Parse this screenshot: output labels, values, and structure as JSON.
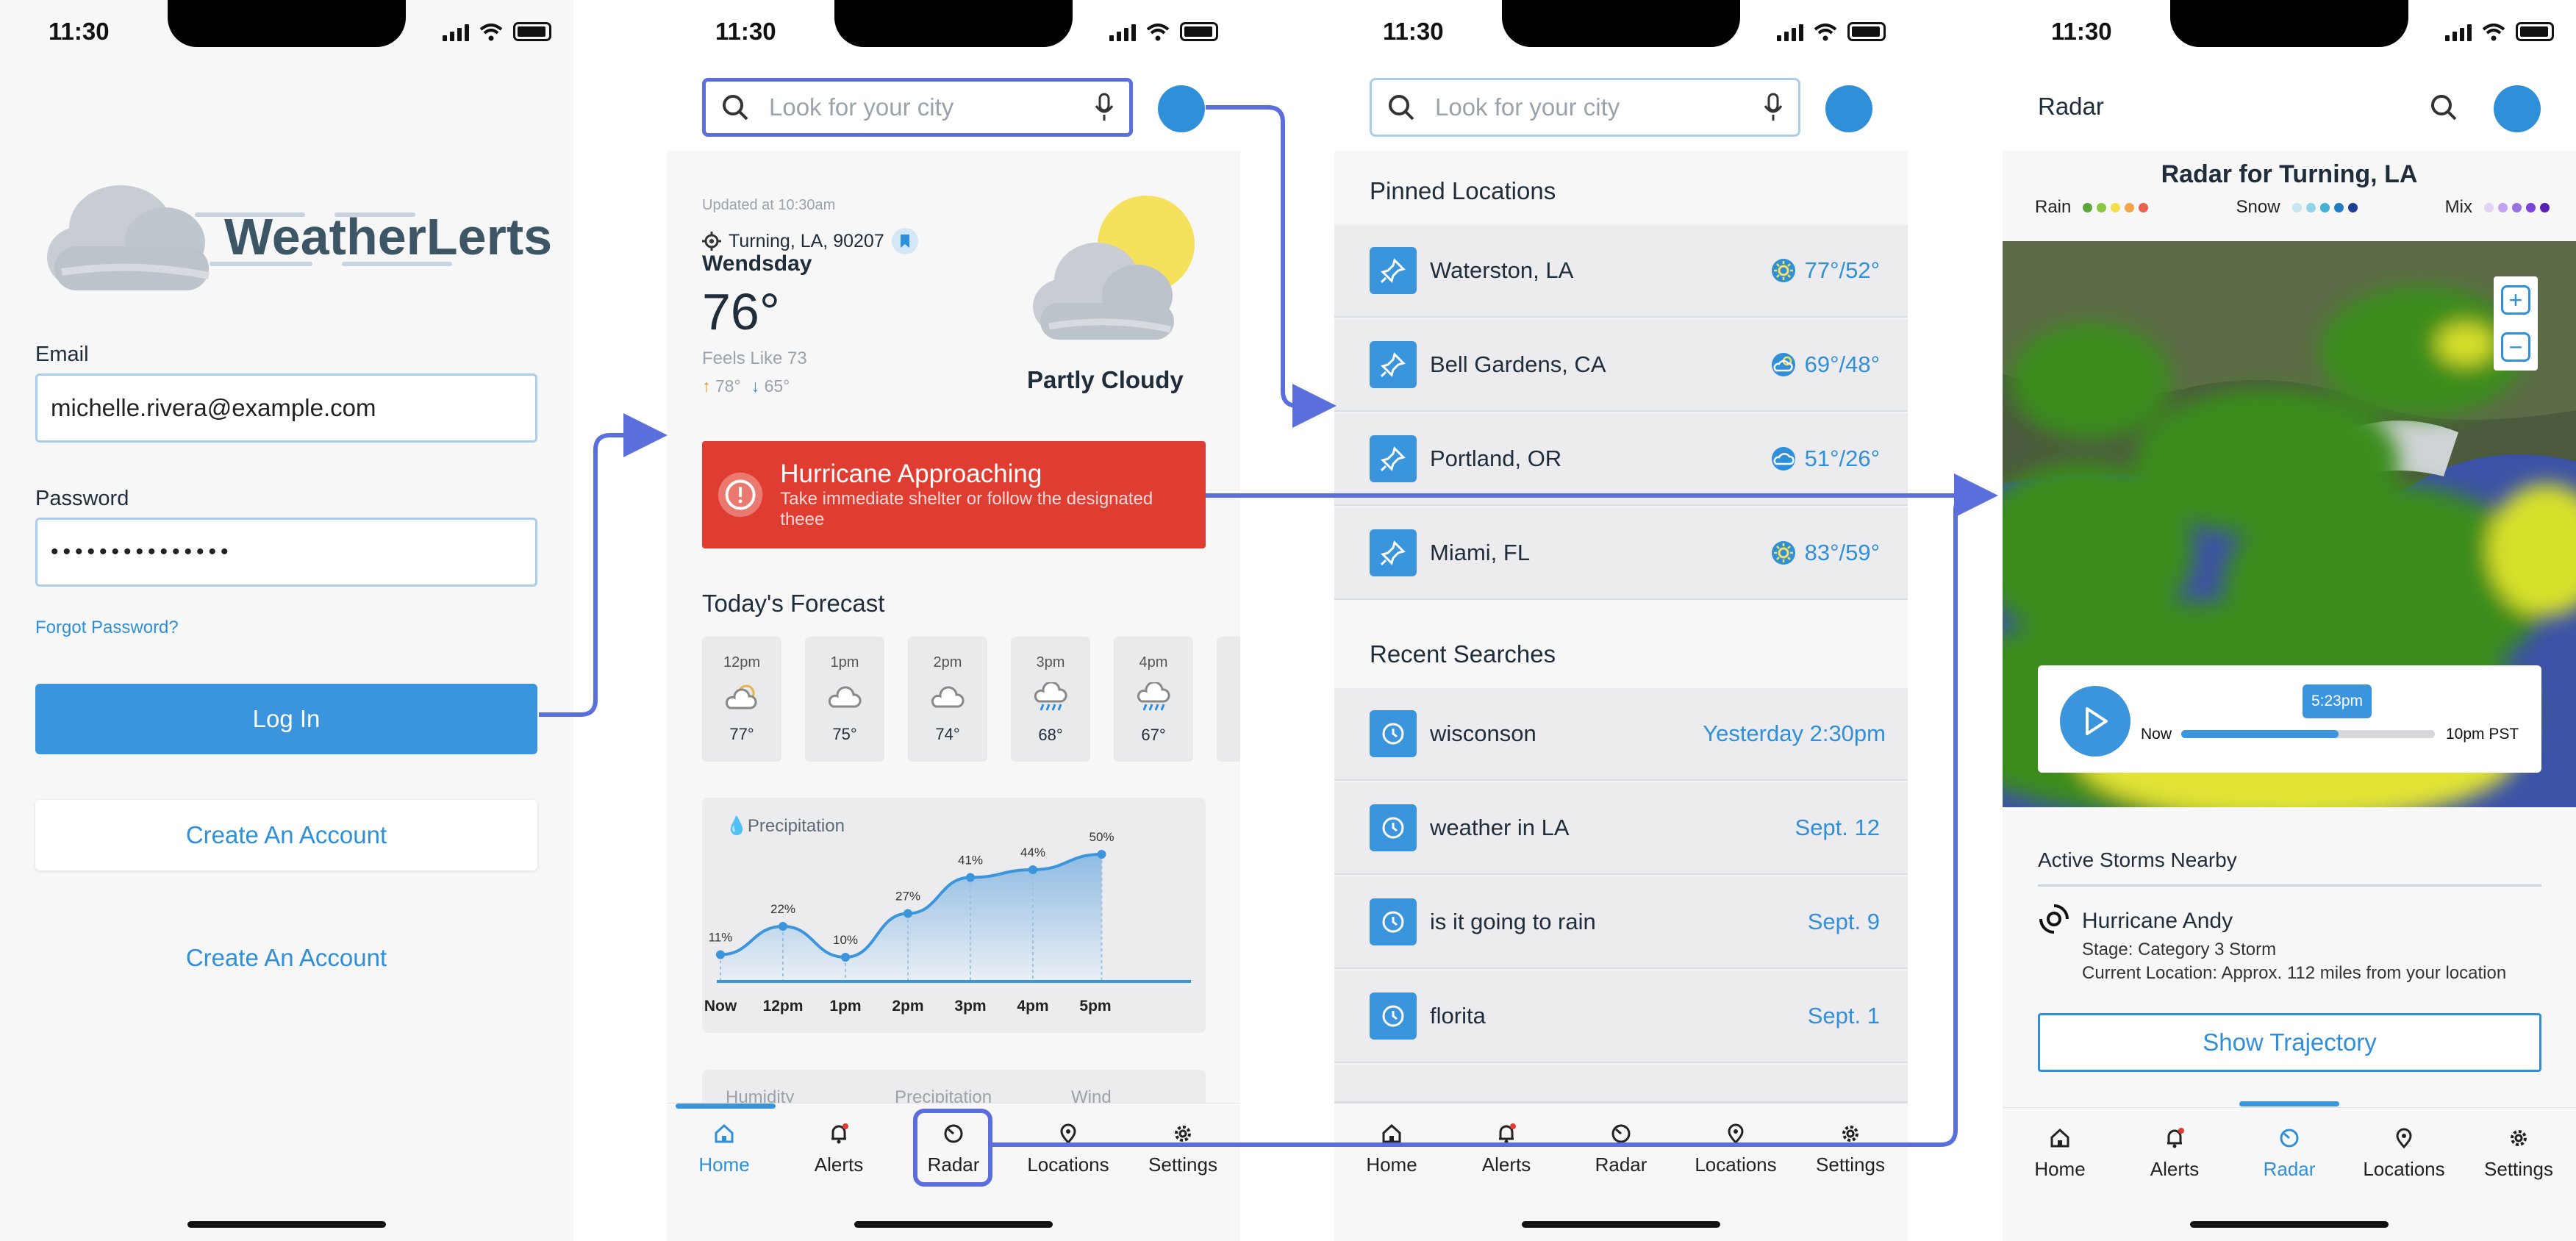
{
  "status_time": "11:30",
  "login": {
    "logo": "WeatherLerts",
    "email_label": "Email",
    "email_value": "michelle.rivera@example.com",
    "password_label": "Password",
    "password_mask": "•••••••••••••••",
    "forgot": "Forgot Password?",
    "login_btn": "Log In",
    "create_btn": "Create An Account",
    "create_link": "Create An Account"
  },
  "search": {
    "placeholder": "Look for your city"
  },
  "home": {
    "updated": "Updated at 10:30am",
    "location": "Turning, LA, 90207",
    "day": "Wendsday",
    "temp": "76°",
    "feels": "Feels Like 73",
    "high": "78°",
    "low": "65°",
    "condition": "Partly Cloudy",
    "alert_title": "Hurricane Approaching",
    "alert_sub": "Take immediate shelter or follow the designated theee",
    "forecast_title": "Today's Forecast",
    "hours": [
      {
        "time": "12pm",
        "temp": "77°"
      },
      {
        "time": "1pm",
        "temp": "75°"
      },
      {
        "time": "2pm",
        "temp": "74°"
      },
      {
        "time": "3pm",
        "temp": "68°"
      },
      {
        "time": "4pm",
        "temp": "67°"
      }
    ],
    "precip_label": "Precipitation",
    "next_tabs": [
      "Humidity",
      "Precipitation",
      "Wind"
    ]
  },
  "chart_data": {
    "type": "area",
    "title": "Precipitation",
    "categories": [
      "Now",
      "12pm",
      "1pm",
      "2pm",
      "3pm",
      "4pm",
      "5pm"
    ],
    "x": [
      0,
      1,
      2,
      3,
      4,
      5,
      6
    ],
    "point_x": [
      0,
      1,
      2,
      3,
      4,
      5,
      6.1
    ],
    "values": [
      11,
      22,
      10,
      27,
      41,
      44,
      50
    ],
    "labels": [
      "11%",
      "22%",
      "10%",
      "27%",
      "41%",
      "44%",
      "50%"
    ],
    "unit": "%"
  },
  "nav": {
    "items": [
      "Home",
      "Alerts",
      "Radar",
      "Locations",
      "Settings"
    ]
  },
  "locations": {
    "pinned_title": "Pinned Locations",
    "pinned": [
      {
        "name": "Waterston, LA",
        "temp": "77°/52°",
        "icon": "sun-icon"
      },
      {
        "name": "Bell Gardens, CA",
        "temp": "69°/48°",
        "icon": "partly-cloudy-icon"
      },
      {
        "name": "Portland, OR",
        "temp": "51°/26°",
        "icon": "cloud-icon"
      },
      {
        "name": "Miami, FL",
        "temp": "83°/59°",
        "icon": "sun-icon"
      }
    ],
    "recent_title": "Recent Searches",
    "recent": [
      {
        "query": "wisconson",
        "when": "Yesterday 2:30pm"
      },
      {
        "query": "weather in LA",
        "when": "Sept. 12"
      },
      {
        "query": "is it going to rain",
        "when": "Sept. 9"
      },
      {
        "query": "florita",
        "when": "Sept. 1"
      }
    ]
  },
  "radar": {
    "title": "Radar",
    "map_title": "Radar for Turning, LA",
    "legend": [
      {
        "label": "Rain",
        "colors": [
          "#5aa63a",
          "#8cc63f",
          "#f4e04d",
          "#f5a64a",
          "#ec5f4f"
        ]
      },
      {
        "label": "Snow",
        "colors": [
          "#c3e6ef",
          "#8fd3e8",
          "#43b0d8",
          "#1f7bc2",
          "#1c3f92"
        ]
      },
      {
        "label": "Mix",
        "colors": [
          "#e2d3f5",
          "#c1a3ef",
          "#9a71e2",
          "#7a42d6",
          "#5a20b3"
        ]
      }
    ],
    "player_now": "Now",
    "player_time": "5:23pm",
    "player_end": "10pm PST",
    "progress": 0.62,
    "storms_title": "Active Storms Nearby",
    "storm_name": "Hurricane Andy",
    "storm_stage": "Stage: Category 3 Storm",
    "storm_location": "Current Location: Approx. 112 miles from your location",
    "trajectory_btn": "Show Trajectory"
  },
  "colors": {
    "accent": "#3b95dd",
    "alert": "#e03d32",
    "flow": "#5a6fdc"
  }
}
